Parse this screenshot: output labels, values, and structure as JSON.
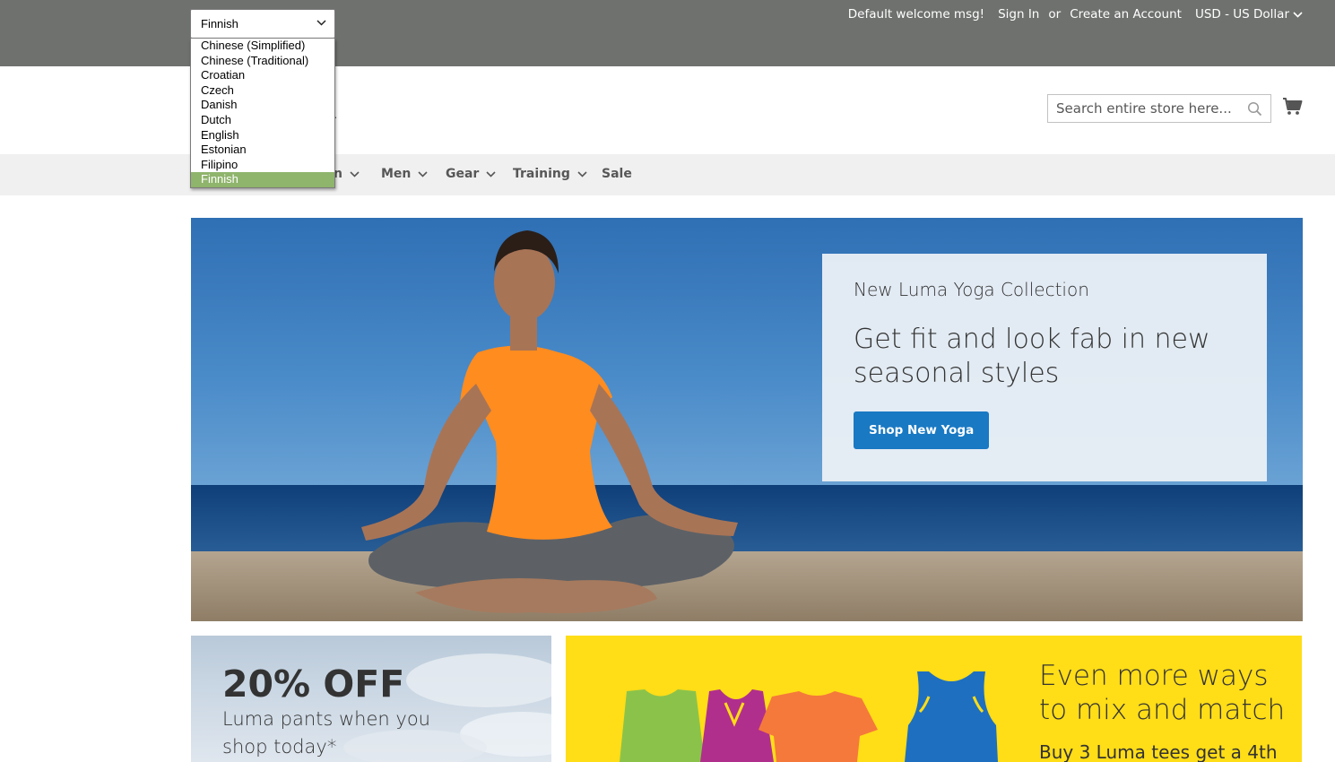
{
  "header": {
    "welcome": "Default welcome msg!",
    "sign_in": "Sign In",
    "or": "or",
    "create_account": "Create an Account",
    "currency": "USD - US Dollar"
  },
  "language_select": {
    "value": "Finnish",
    "options": [
      "Chinese (Simplified)",
      "Chinese (Traditional)",
      "Croatian",
      "Czech",
      "Danish",
      "Dutch",
      "English",
      "Estonian",
      "Filipino",
      "Finnish"
    ],
    "highlighted": "Finnish"
  },
  "search": {
    "placeholder": "Search entire store here..."
  },
  "nav": {
    "items": [
      {
        "label": "n"
      },
      {
        "label": "Men"
      },
      {
        "label": "Gear"
      },
      {
        "label": "Training"
      },
      {
        "label": "Sale"
      }
    ]
  },
  "hero": {
    "kicker": "New Luma Yoga Collection",
    "title": "Get fit and look fab in new seasonal styles",
    "button": "Shop New Yoga"
  },
  "promo_pants": {
    "headline": "20% OFF",
    "text": "Luma pants when you shop today*"
  },
  "promo_tees": {
    "headline": "Even more ways to mix and match",
    "text": "Buy 3 Luma tees get a 4th"
  },
  "colors": {
    "top_bar": "#6e716e",
    "accent_blue": "#1979c3",
    "selected_option": "#8fb46c",
    "promo_yellow": "#ffdd17"
  },
  "icons": [
    "chevron-down-icon",
    "search-icon",
    "cart-icon"
  ]
}
